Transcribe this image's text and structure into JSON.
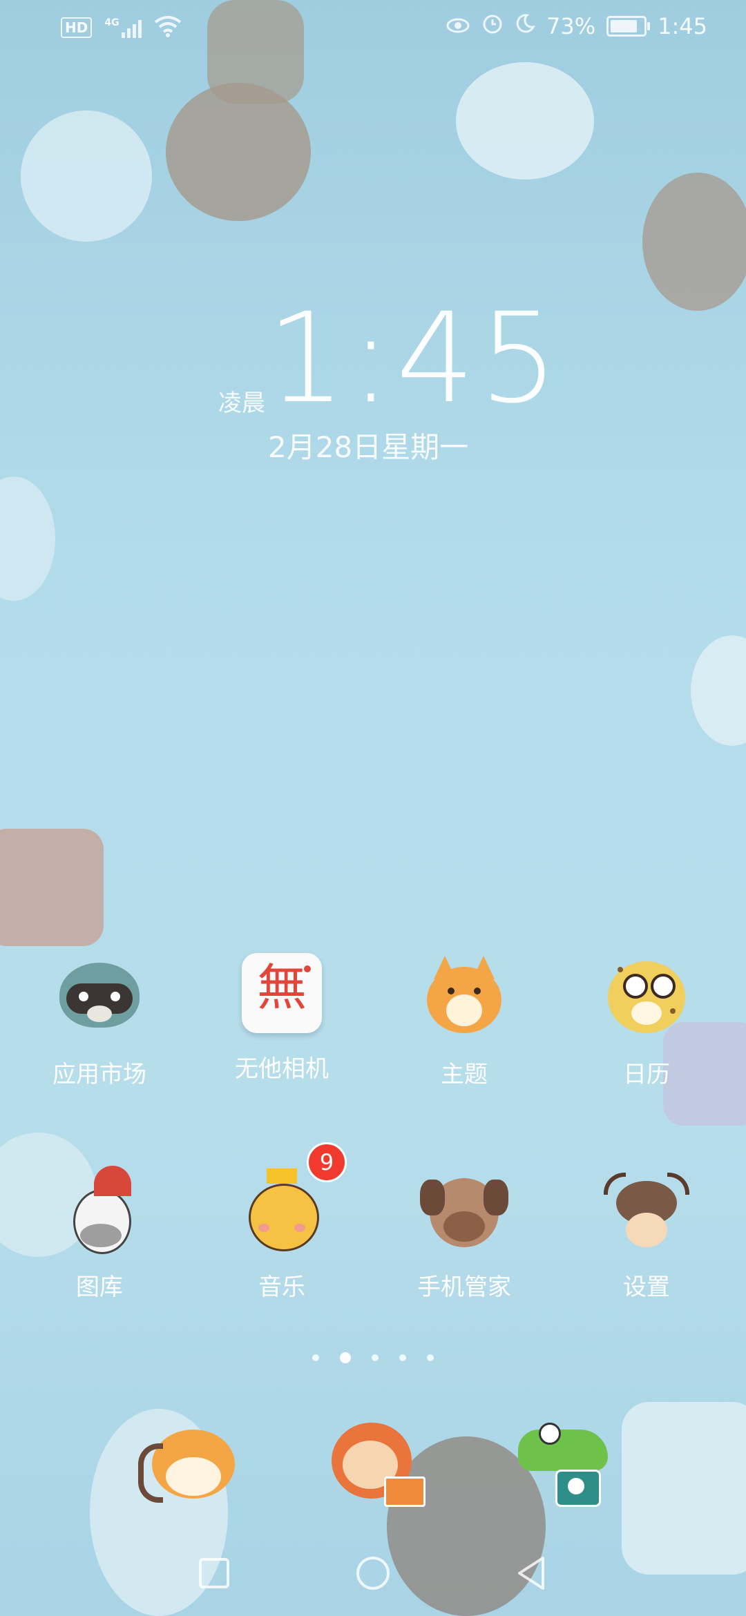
{
  "status_bar": {
    "hd": "HD",
    "network": "4G",
    "battery_percent": "73%",
    "time": "1:45",
    "battery_level": 0.73,
    "icons": [
      "signal-icon",
      "wifi-icon",
      "eye-comfort-icon",
      "alarm-icon",
      "do-not-disturb-icon",
      "battery-icon"
    ]
  },
  "clock": {
    "time": "1:45",
    "period": "凌晨",
    "date": "2月28日星期一"
  },
  "apps": [
    {
      "label": "应用市场",
      "icon": "raccoon-icon"
    },
    {
      "label": "无他相机",
      "icon": "wuta-camera-icon",
      "glyph": "無"
    },
    {
      "label": "主题",
      "icon": "fox-icon"
    },
    {
      "label": "日历",
      "icon": "leopard-icon"
    },
    {
      "label": "图库",
      "icon": "zebra-icon"
    },
    {
      "label": "音乐",
      "icon": "bee-icon",
      "badge": "9"
    },
    {
      "label": "手机管家",
      "icon": "dog-icon"
    },
    {
      "label": "设置",
      "icon": "yak-icon"
    }
  ],
  "pages": {
    "count": 5,
    "active": 1
  },
  "dock": [
    "phone-fox-icon",
    "messages-sloth-icon",
    "camera-crocodile-icon"
  ],
  "colors": {
    "background": "#b3dcea",
    "badge": "#f03a2e",
    "text": "#ffffff"
  }
}
